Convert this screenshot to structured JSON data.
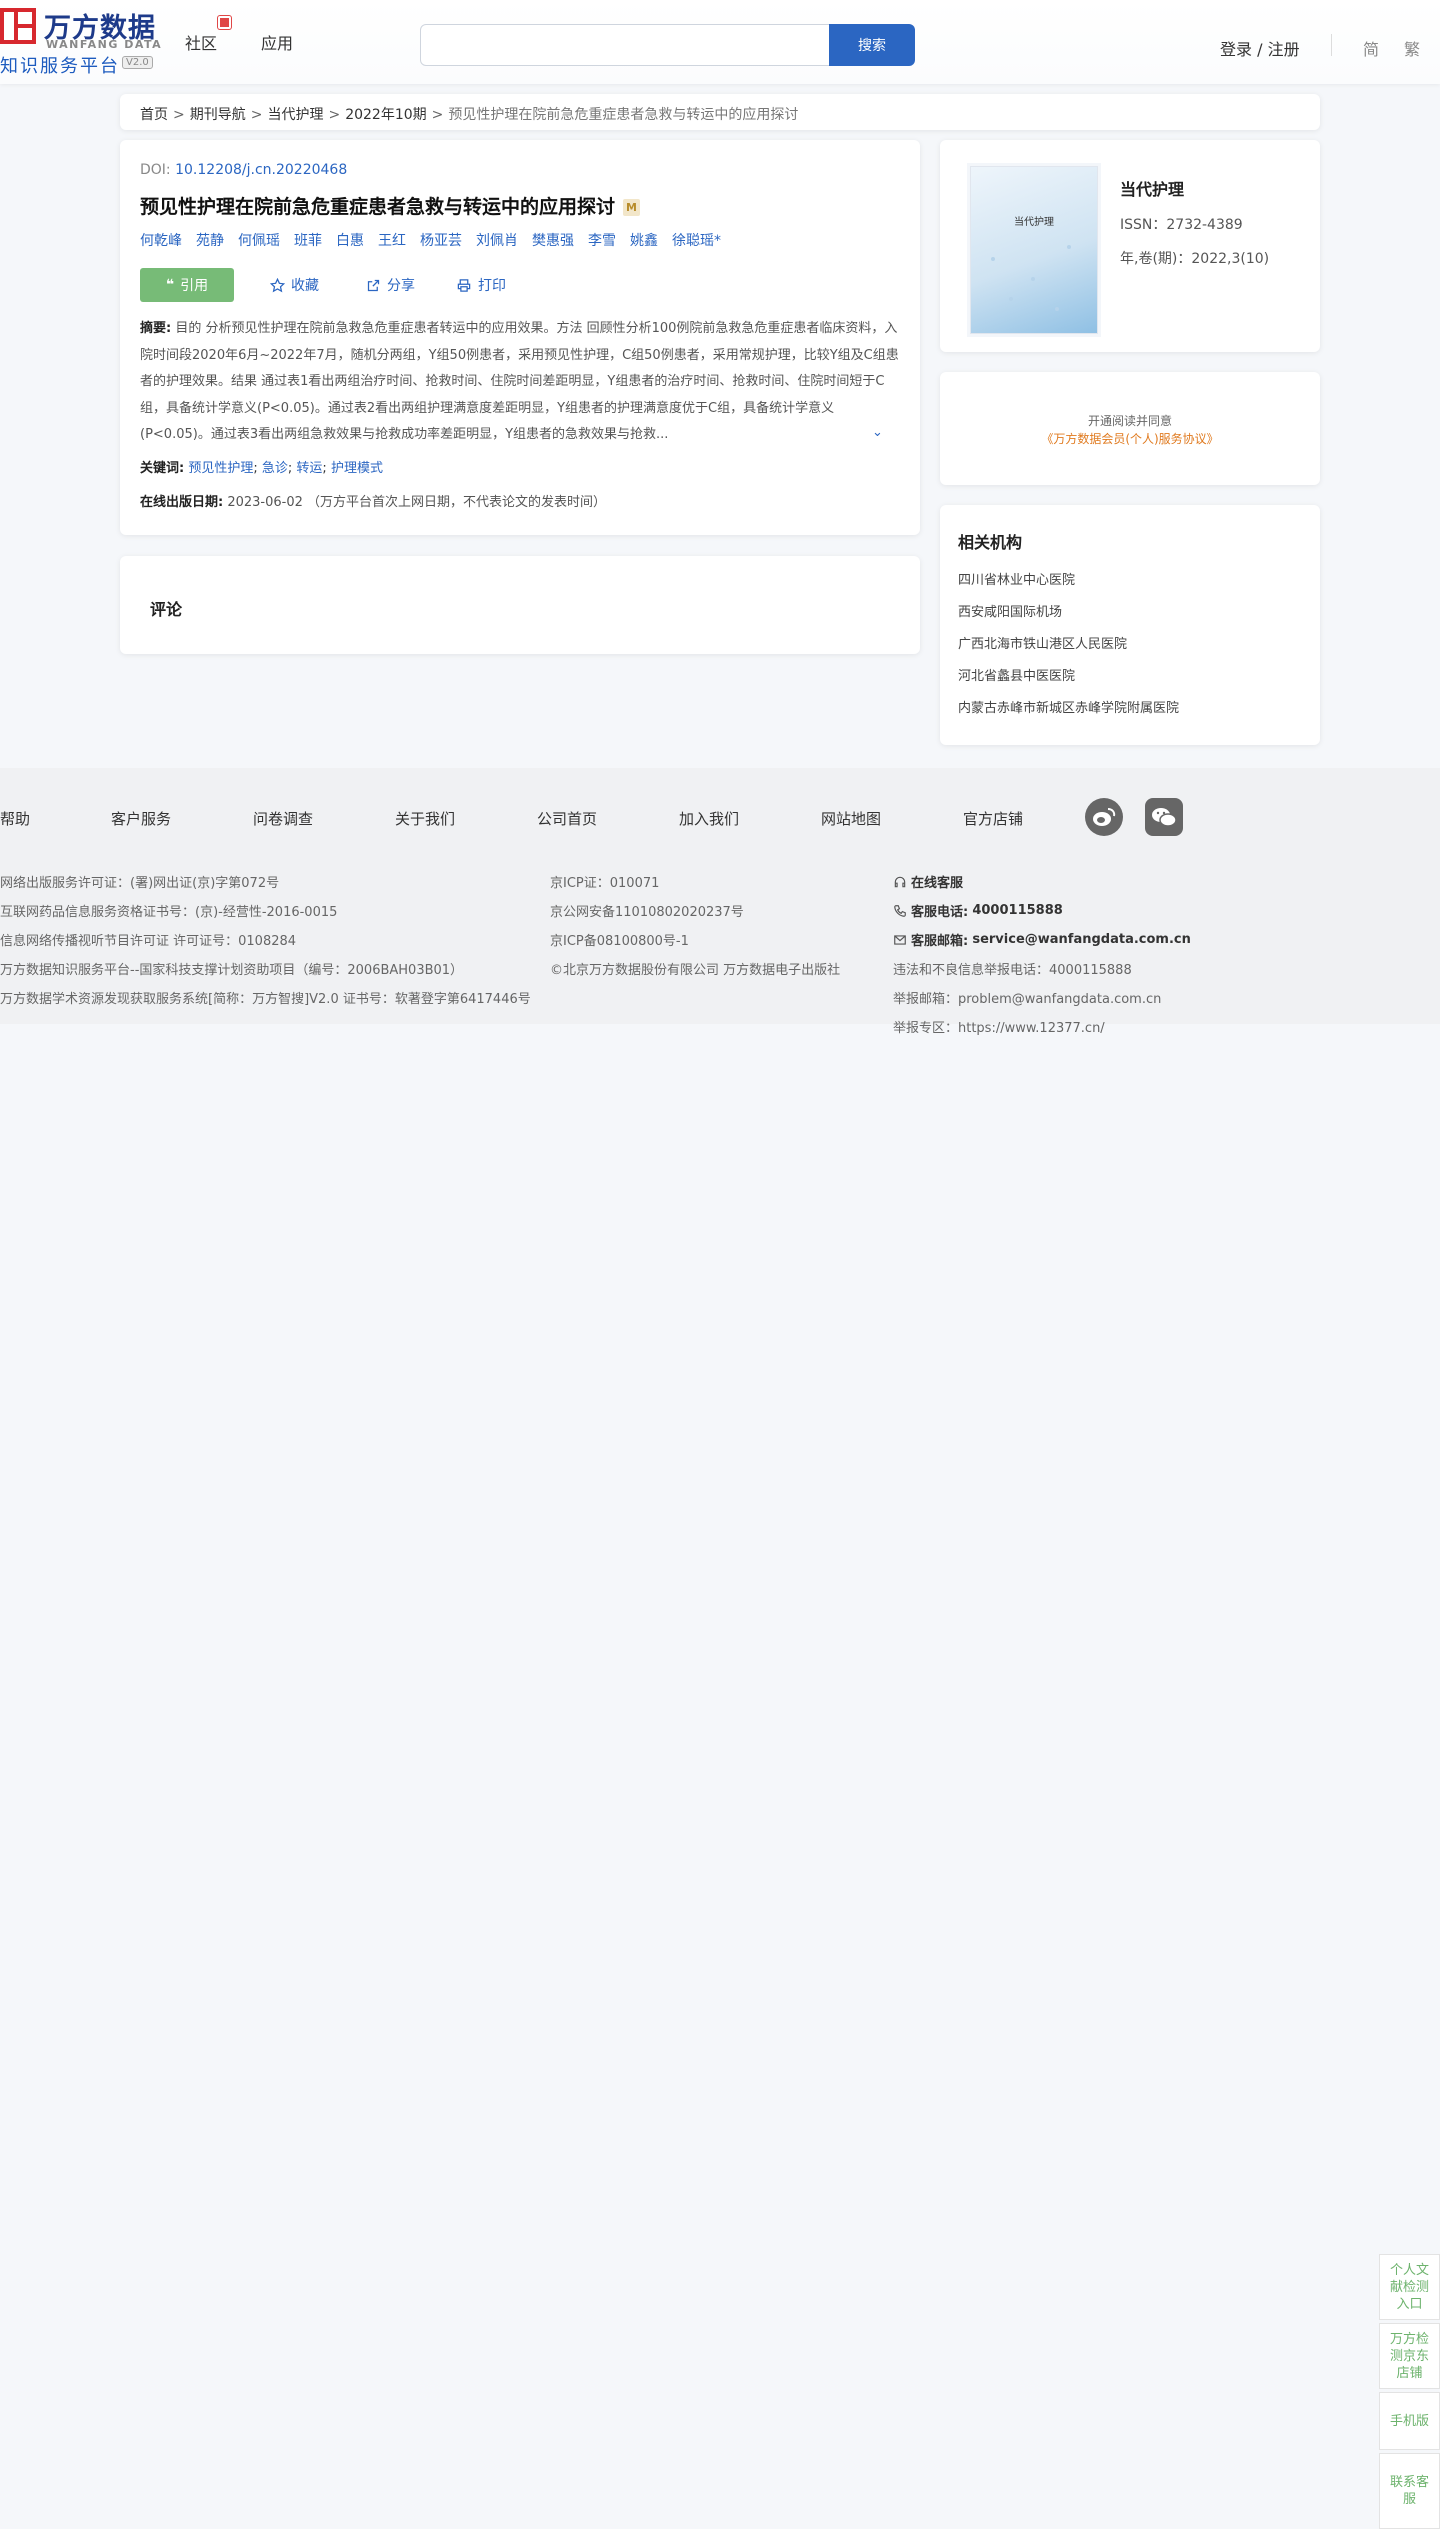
{
  "header": {
    "logo_cn": "万方数据",
    "logo_en": "WANFANG DATA",
    "logo_sub": "知识服务平台",
    "logo_version": "V2.0",
    "nav": [
      "社区",
      "应用"
    ],
    "search_placeholder": "",
    "search_button": "搜索",
    "login": "登录 / 注册",
    "lang_simplified": "简",
    "lang_traditional": "繁"
  },
  "breadcrumb": [
    "首页",
    "期刊导航",
    "当代护理",
    "2022年10期",
    "预见性护理在院前急危重症患者急救与转运中的应用探讨"
  ],
  "breadcrumb_sep": ">",
  "article": {
    "doi_label": "DOI:",
    "doi": "10.12208/j.cn.20220468",
    "title": "预见性护理在院前急危重症患者急救与转运中的应用探讨",
    "title_badge": "M",
    "authors": [
      "何乾峰",
      "苑静",
      "何佩瑶",
      "班菲",
      "白惠",
      "王红",
      "杨亚芸",
      "刘佩肖",
      "樊惠强",
      "李雪",
      "姚鑫",
      "徐聪瑶*"
    ],
    "actions": {
      "cite": "引用",
      "favorite": "收藏",
      "share": "分享",
      "print": "打印"
    },
    "abstract_label": "摘要:",
    "abstract": "目的 分析预见性护理在院前急救急危重症患者转运中的应用效果。方法 回顾性分析100例院前急救急危重症患者临床资料，入院时间段2020年6月~2022年7月，随机分两组，Y组50例患者，采用预见性护理，C组50例患者，采用常规护理，比较Y组及C组患者的护理效果。结果 通过表1看出两组治疗时间、抢救时间、住院时间差距明显，Y组患者的治疗时间、抢救时间、住院时间短于C组，具备统计学意义(P<0.05)。通过表2看出两组护理满意度差距明显，Y组患者的护理满意度优于C组，具备统计学意义(P<0.05)。通过表3看出两组急救效果与抢救成功率差距明显，Y组患者的急救效果与抢救...",
    "keywords_label": "关键词:",
    "keywords": [
      "预见性护理",
      "急诊",
      "转运",
      "护理模式"
    ],
    "pubdate_label": "在线出版日期:",
    "pubdate": "2023-06-02",
    "pubdate_note": "（万方平台首次上网日期，不代表论文的发表时间）"
  },
  "comment_title": "评论",
  "journal": {
    "cover_title": "当代护理",
    "name": "当代护理",
    "issn": "ISSN：2732-4389",
    "year_issue": "年,卷(期)：2022,3(10)"
  },
  "agreement": {
    "line1": "开通阅读并同意",
    "line2": "《万方数据会员(个人)服务协议》"
  },
  "orgs": {
    "title": "相关机构",
    "items": [
      "四川省林业中心医院",
      "西安咸阳国际机场",
      "广西北海市铁山港区人民医院",
      "河北省蠡县中医医院",
      "内蒙古赤峰市新城区赤峰学院附属医院"
    ]
  },
  "footer": {
    "links": [
      "帮助",
      "客户服务",
      "问卷调查",
      "关于我们",
      "公司首页",
      "加入我们",
      "网站地图",
      "官方店铺"
    ],
    "col1": [
      "网络出版服务许可证：(署)网出证(京)字第072号",
      "互联网药品信息服务资格证书号：(京)-经营性-2016-0015",
      "信息网络传播视听节目许可证 许可证号：0108284",
      "万方数据知识服务平台--国家科技支撑计划资助项目（编号：2006BAH03B01）",
      "万方数据学术资源发现获取服务系统[简称：万方智搜]V2.0 证书号：软著登字第6417446号"
    ],
    "col2": [
      "京ICP证：010071",
      "京公网安备11010802020237号",
      "京ICP备08100800号-1",
      "©北京万方数据股份有限公司 万方数据电子出版社"
    ],
    "online_service": "在线客服",
    "phone_label": "客服电话:",
    "phone": "4000115888",
    "email_label": "客服邮箱:",
    "email": "service@wanfangdata.com.cn",
    "report_phone": "违法和不良信息举报电话：4000115888",
    "report_email": "举报邮箱：problem@wanfangdata.com.cn",
    "report_site": "举报专区：https://www.12377.cn/"
  },
  "float_bar": [
    "个人文献检测入口",
    "万方检测京东店铺",
    "手机版",
    "联系客服"
  ]
}
